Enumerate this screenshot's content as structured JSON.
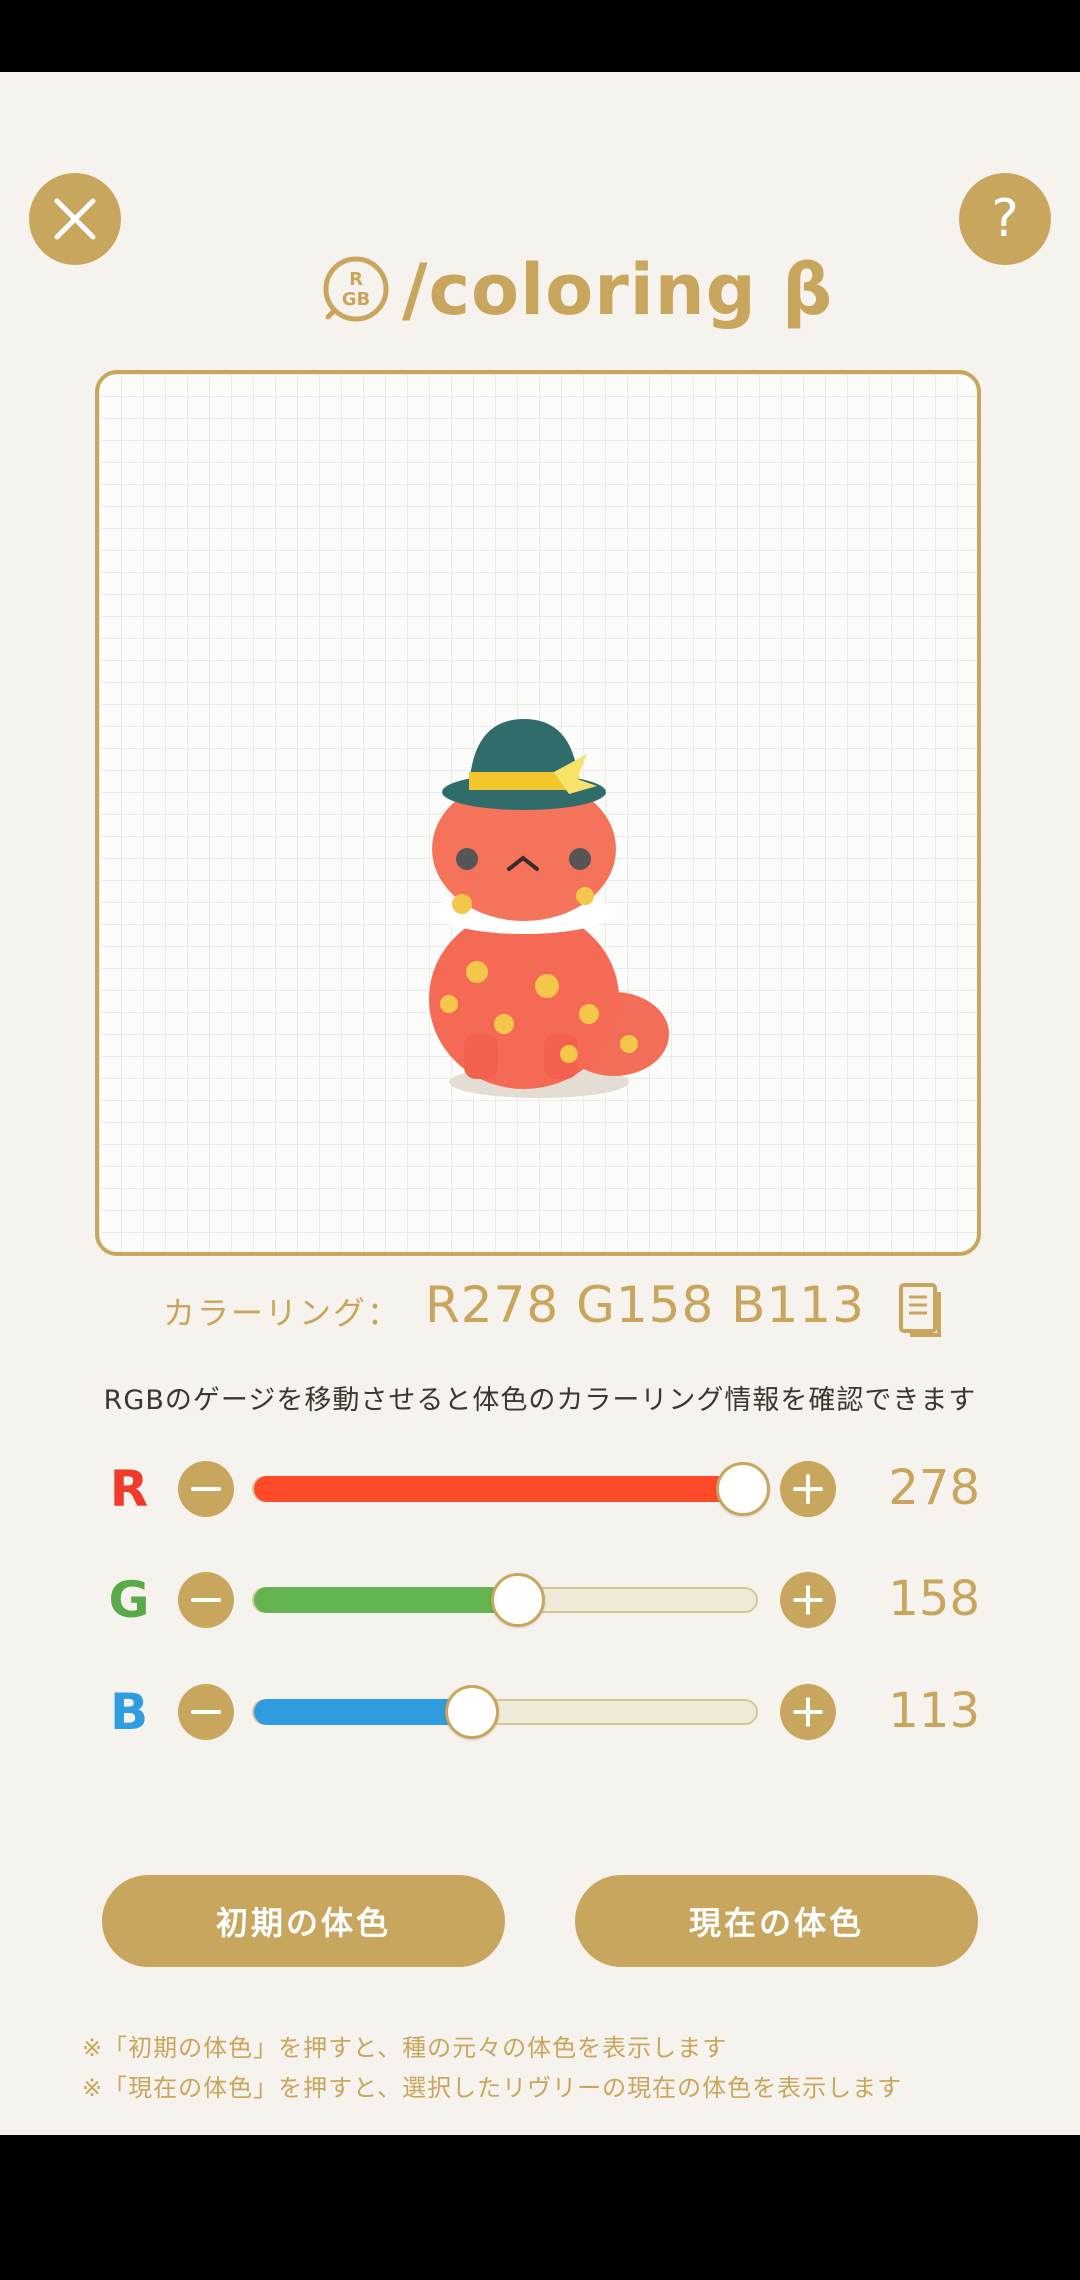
{
  "app": {
    "title": "/coloring β",
    "logo_badge": "RGB"
  },
  "header": {
    "close_icon": "close-icon",
    "help_label": "?"
  },
  "preview": {
    "subject": "character-preview"
  },
  "coloring": {
    "label": "カラーリング：",
    "value": "R278 G158 B113",
    "copy_icon": "copy-document-icon"
  },
  "hint": "RGBのゲージを移動させると体色のカラーリング情報を確認できます",
  "sliders": [
    {
      "channel": "R",
      "value": "278",
      "fraction": 0.975,
      "color": "#ff4a2a",
      "letter_color": "#ef3b2a"
    },
    {
      "channel": "G",
      "value": "158",
      "fraction": 0.525,
      "color": "#63b34f",
      "letter_color": "#5aa94b"
    },
    {
      "channel": "B",
      "value": "113",
      "fraction": 0.435,
      "color": "#2e9cdf",
      "letter_color": "#2f9ee0"
    }
  ],
  "buttons": {
    "initial": "初期の体色",
    "current": "現在の体色"
  },
  "notes": [
    "※「初期の体色」を押すと、種の元々の体色を表示します",
    "※「現在の体色」を押すと、選択したリヴリーの現在の体色を表示します"
  ],
  "colors": {
    "accent": "#c9a65d",
    "background": "#f6f3ee"
  }
}
